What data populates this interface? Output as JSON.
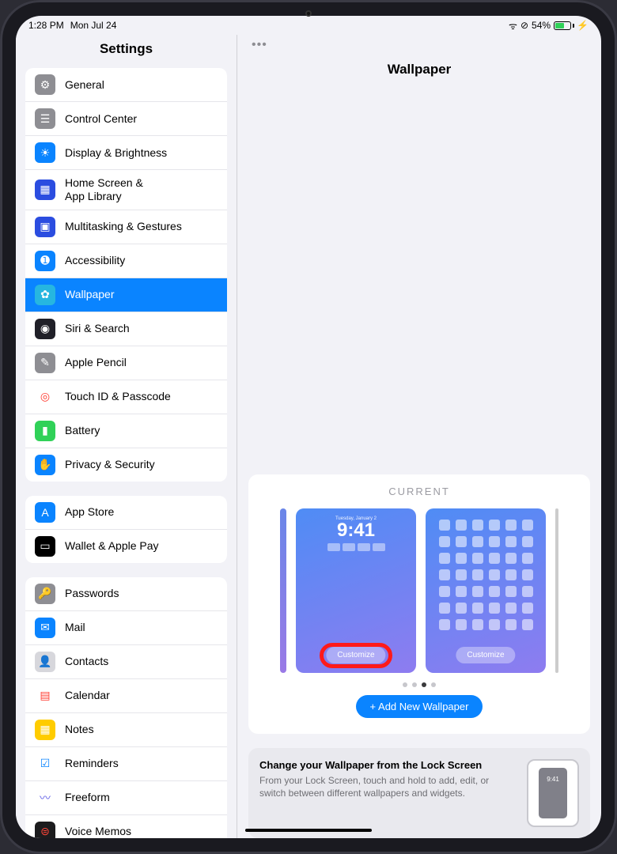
{
  "status": {
    "time": "1:28 PM",
    "date": "Mon Jul 24",
    "battery_pct": "54%"
  },
  "sidebar": {
    "title": "Settings",
    "groups": [
      {
        "items": [
          {
            "name": "general",
            "label": "General",
            "bg": "#8e8e93",
            "glyph": "⚙"
          },
          {
            "name": "control-center",
            "label": "Control Center",
            "bg": "#8e8e93",
            "glyph": "☰"
          },
          {
            "name": "display",
            "label": "Display & Brightness",
            "bg": "#0a84ff",
            "glyph": "☀"
          },
          {
            "name": "home-screen",
            "label": "Home Screen &\nApp Library",
            "bg": "#2b4de0",
            "glyph": "▦"
          },
          {
            "name": "multitasking",
            "label": "Multitasking & Gestures",
            "bg": "#2b4de0",
            "glyph": "▣"
          },
          {
            "name": "accessibility",
            "label": "Accessibility",
            "bg": "#0a84ff",
            "glyph": "➊"
          },
          {
            "name": "wallpaper",
            "label": "Wallpaper",
            "bg": "#26b6e0",
            "glyph": "✿",
            "selected": true
          },
          {
            "name": "siri",
            "label": "Siri & Search",
            "bg": "#202028",
            "glyph": "◉"
          },
          {
            "name": "apple-pencil",
            "label": "Apple Pencil",
            "bg": "#8e8e93",
            "glyph": "✎"
          },
          {
            "name": "touch-id",
            "label": "Touch ID & Passcode",
            "bg": "#ffffff",
            "glyph": "◎",
            "fg": "#ff3b30"
          },
          {
            "name": "battery",
            "label": "Battery",
            "bg": "#30d158",
            "glyph": "▮"
          },
          {
            "name": "privacy",
            "label": "Privacy & Security",
            "bg": "#0a84ff",
            "glyph": "✋"
          }
        ]
      },
      {
        "items": [
          {
            "name": "app-store",
            "label": "App Store",
            "bg": "#0a84ff",
            "glyph": "A"
          },
          {
            "name": "wallet",
            "label": "Wallet & Apple Pay",
            "bg": "#000",
            "glyph": "▭"
          }
        ]
      },
      {
        "items": [
          {
            "name": "passwords",
            "label": "Passwords",
            "bg": "#8e8e93",
            "glyph": "🔑"
          },
          {
            "name": "mail",
            "label": "Mail",
            "bg": "#0a84ff",
            "glyph": "✉"
          },
          {
            "name": "contacts",
            "label": "Contacts",
            "bg": "#d7d7dc",
            "glyph": "👤",
            "fg": "#555"
          },
          {
            "name": "calendar",
            "label": "Calendar",
            "bg": "#ffffff",
            "glyph": "▤",
            "fg": "#ff3b30"
          },
          {
            "name": "notes",
            "label": "Notes",
            "bg": "#ffcc00",
            "glyph": "▦",
            "fg": "#fff"
          },
          {
            "name": "reminders",
            "label": "Reminders",
            "bg": "#ffffff",
            "glyph": "☑",
            "fg": "#0a84ff"
          },
          {
            "name": "freeform",
            "label": "Freeform",
            "bg": "#ffffff",
            "glyph": "〰",
            "fg": "#5e5ce6"
          },
          {
            "name": "voice-memos",
            "label": "Voice Memos",
            "bg": "#1c1c1e",
            "glyph": "⊜",
            "fg": "#ff453a"
          }
        ]
      }
    ]
  },
  "detail": {
    "title": "Wallpaper",
    "current_label": "CURRENT",
    "lock_time_date": "Tuesday, January 2",
    "lock_time": "9:41",
    "customize_label": "Customize",
    "add_new_label": "+ Add New Wallpaper",
    "active_dot_index": 2,
    "tip": {
      "title": "Change your Wallpaper from the Lock Screen",
      "body": "From your Lock Screen, touch and hold to add, edit, or switch between different wallpapers and widgets.",
      "illus_time": "9:41"
    }
  }
}
